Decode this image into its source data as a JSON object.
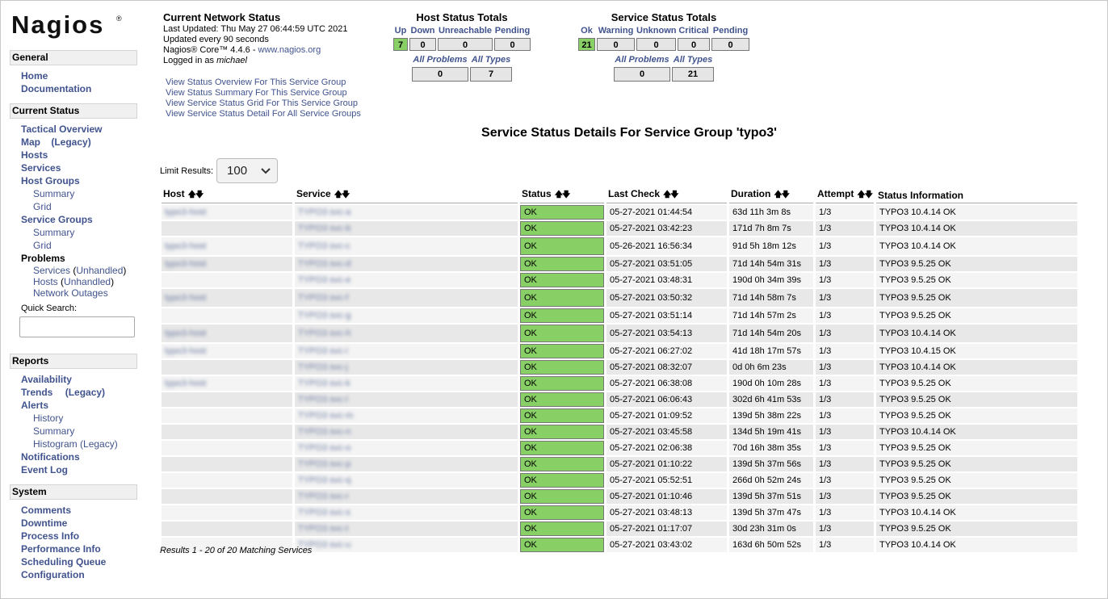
{
  "brand": {
    "logo_text": "Nagios",
    "reg": "®"
  },
  "sidebar": {
    "general": {
      "title": "General",
      "items": [
        "Home",
        "Documentation"
      ]
    },
    "current_status": {
      "title": "Current Status",
      "tactical": "Tactical Overview",
      "map": "Map",
      "map_legacy": "(Legacy)",
      "hosts": "Hosts",
      "services": "Services",
      "host_groups": "Host Groups",
      "hg_summary": "Summary",
      "hg_grid": "Grid",
      "service_groups": "Service Groups",
      "sg_summary": "Summary",
      "sg_grid": "Grid",
      "problems": "Problems",
      "p_services": "Services",
      "p_services_unh": "Unhandled",
      "p_hosts": "Hosts",
      "p_hosts_unh": "Unhandled",
      "p_outages": "Network Outages",
      "quick_search": "Quick Search:"
    },
    "reports": {
      "title": "Reports",
      "availability": "Availability",
      "trends": "Trends",
      "trends_legacy": "(Legacy)",
      "alerts": "Alerts",
      "history": "History",
      "summary": "Summary",
      "histogram": "Histogram",
      "histogram_legacy": "(Legacy)",
      "notifications": "Notifications",
      "event_log": "Event Log"
    },
    "system": {
      "title": "System",
      "items": [
        "Comments",
        "Downtime",
        "Process Info",
        "Performance Info",
        "Scheduling Queue",
        "Configuration"
      ]
    }
  },
  "network_status": {
    "title": "Current Network Status",
    "last_updated": "Last Updated: Thu May 27 06:44:59 UTC 2021",
    "update_every": "Updated every 90 seconds",
    "core": "Nagios® Core™ 4.4.6 - ",
    "core_link": "www.nagios.org",
    "logged_in_prefix": "Logged in as ",
    "user": "michael"
  },
  "group_links": [
    "View Status Overview For This Service Group",
    "View Status Summary For This Service Group",
    "View Service Status Grid For This Service Group",
    "View Service Status Detail For All Service Groups"
  ],
  "host_totals": {
    "title": "Host Status Totals",
    "headers": [
      "Up",
      "Down",
      "Unreachable",
      "Pending"
    ],
    "values": [
      "7",
      "0",
      "0",
      "0"
    ],
    "sub_headers": [
      "All Problems",
      "All Types"
    ],
    "sub_values": [
      "0",
      "7"
    ]
  },
  "service_totals": {
    "title": "Service Status Totals",
    "headers": [
      "Ok",
      "Warning",
      "Unknown",
      "Critical",
      "Pending"
    ],
    "values": [
      "21",
      "0",
      "0",
      "0",
      "0"
    ],
    "sub_headers": [
      "All Problems",
      "All Types"
    ],
    "sub_values": [
      "0",
      "21"
    ]
  },
  "page_title": "Service Status Details For Service Group 'typo3'",
  "limit": {
    "label": "Limit Results:",
    "value": "100"
  },
  "table": {
    "headers": [
      "Host",
      "Service",
      "Status",
      "Last Check",
      "Duration",
      "Attempt",
      "Status Information"
    ],
    "rows": [
      {
        "host": "typo3-host",
        "service": "TYPO3 svc-a",
        "status": "OK",
        "last_check": "05-27-2021 01:44:54",
        "duration": "63d 11h 3m 8s",
        "attempt": "1/3",
        "info": "TYPO3 10.4.14 OK"
      },
      {
        "host": "",
        "service": "TYPO3 svc-b",
        "status": "OK",
        "last_check": "05-27-2021 03:42:23",
        "duration": "171d 7h 8m 7s",
        "attempt": "1/3",
        "info": "TYPO3 10.4.14 OK"
      },
      {
        "host": "typo3-host",
        "service": "TYPO3 svc-c",
        "status": "OK",
        "last_check": "05-26-2021 16:56:34",
        "duration": "91d 5h 18m 12s",
        "attempt": "1/3",
        "info": "TYPO3 10.4.14 OK"
      },
      {
        "host": "typo3-host",
        "service": "TYPO3 svc-d",
        "status": "OK",
        "last_check": "05-27-2021 03:51:05",
        "duration": "71d 14h 54m 31s",
        "attempt": "1/3",
        "info": "TYPO3 9.5.25 OK"
      },
      {
        "host": "",
        "service": "TYPO3 svc-e",
        "status": "OK",
        "last_check": "05-27-2021 03:48:31",
        "duration": "190d 0h 34m 39s",
        "attempt": "1/3",
        "info": "TYPO3 9.5.25 OK"
      },
      {
        "host": "typo3-host",
        "service": "TYPO3 svc-f",
        "status": "OK",
        "last_check": "05-27-2021 03:50:32",
        "duration": "71d 14h 58m 7s",
        "attempt": "1/3",
        "info": "TYPO3 9.5.25 OK"
      },
      {
        "host": "",
        "service": "TYPO3 svc-g",
        "status": "OK",
        "last_check": "05-27-2021 03:51:14",
        "duration": "71d 14h 57m 2s",
        "attempt": "1/3",
        "info": "TYPO3 9.5.25 OK"
      },
      {
        "host": "typo3-host",
        "service": "TYPO3 svc-h",
        "status": "OK",
        "last_check": "05-27-2021 03:54:13",
        "duration": "71d 14h 54m 20s",
        "attempt": "1/3",
        "info": "TYPO3 10.4.14 OK"
      },
      {
        "host": "typo3-host",
        "service": "TYPO3 svc-i",
        "status": "OK",
        "last_check": "05-27-2021 06:27:02",
        "duration": "41d 18h 17m 57s",
        "attempt": "1/3",
        "info": "TYPO3 10.4.15 OK"
      },
      {
        "host": "",
        "service": "TYPO3 svc-j",
        "status": "OK",
        "last_check": "05-27-2021 08:32:07",
        "duration": "0d 0h 6m 23s",
        "attempt": "1/3",
        "info": "TYPO3 10.4.14 OK"
      },
      {
        "host": "typo3-host",
        "service": "TYPO3 svc-k",
        "status": "OK",
        "last_check": "05-27-2021 06:38:08",
        "duration": "190d 0h 10m 28s",
        "attempt": "1/3",
        "info": "TYPO3 9.5.25 OK"
      },
      {
        "host": "",
        "service": "TYPO3 svc-l",
        "status": "OK",
        "last_check": "05-27-2021 06:06:43",
        "duration": "302d 6h 41m 53s",
        "attempt": "1/3",
        "info": "TYPO3 9.5.25 OK"
      },
      {
        "host": "",
        "service": "TYPO3 svc-m",
        "status": "OK",
        "last_check": "05-27-2021 01:09:52",
        "duration": "139d 5h 38m 22s",
        "attempt": "1/3",
        "info": "TYPO3 9.5.25 OK"
      },
      {
        "host": "",
        "service": "TYPO3 svc-n",
        "status": "OK",
        "last_check": "05-27-2021 03:45:58",
        "duration": "134d 5h 19m 41s",
        "attempt": "1/3",
        "info": "TYPO3 10.4.14 OK"
      },
      {
        "host": "",
        "service": "TYPO3 svc-o",
        "status": "OK",
        "last_check": "05-27-2021 02:06:38",
        "duration": "70d 16h 38m 35s",
        "attempt": "1/3",
        "info": "TYPO3 9.5.25 OK"
      },
      {
        "host": "",
        "service": "TYPO3 svc-p",
        "status": "OK",
        "last_check": "05-27-2021 01:10:22",
        "duration": "139d 5h 37m 56s",
        "attempt": "1/3",
        "info": "TYPO3 9.5.25 OK"
      },
      {
        "host": "",
        "service": "TYPO3 svc-q",
        "status": "OK",
        "last_check": "05-27-2021 05:52:51",
        "duration": "266d 0h 52m 24s",
        "attempt": "1/3",
        "info": "TYPO3 9.5.25 OK"
      },
      {
        "host": "",
        "service": "TYPO3 svc-r",
        "status": "OK",
        "last_check": "05-27-2021 01:10:46",
        "duration": "139d 5h 37m 51s",
        "attempt": "1/3",
        "info": "TYPO3 9.5.25 OK"
      },
      {
        "host": "",
        "service": "TYPO3 svc-s",
        "status": "OK",
        "last_check": "05-27-2021 03:48:13",
        "duration": "139d 5h 37m 47s",
        "attempt": "1/3",
        "info": "TYPO3 10.4.14 OK"
      },
      {
        "host": "",
        "service": "TYPO3 svc-t",
        "status": "OK",
        "last_check": "05-27-2021 01:17:07",
        "duration": "30d 23h 31m 0s",
        "attempt": "1/3",
        "info": "TYPO3 9.5.25 OK"
      },
      {
        "host": "",
        "service": "TYPO3 svc-u",
        "status": "OK",
        "last_check": "05-27-2021 03:43:02",
        "duration": "163d 6h 50m 52s",
        "attempt": "1/3",
        "info": "TYPO3 10.4.14 OK"
      }
    ]
  },
  "results_text": "Results 1 - 20 of 20 Matching Services",
  "colors": {
    "ok_green": "#88d066",
    "link_blue": "#40538e",
    "box_grey": "#e5e5e5"
  }
}
